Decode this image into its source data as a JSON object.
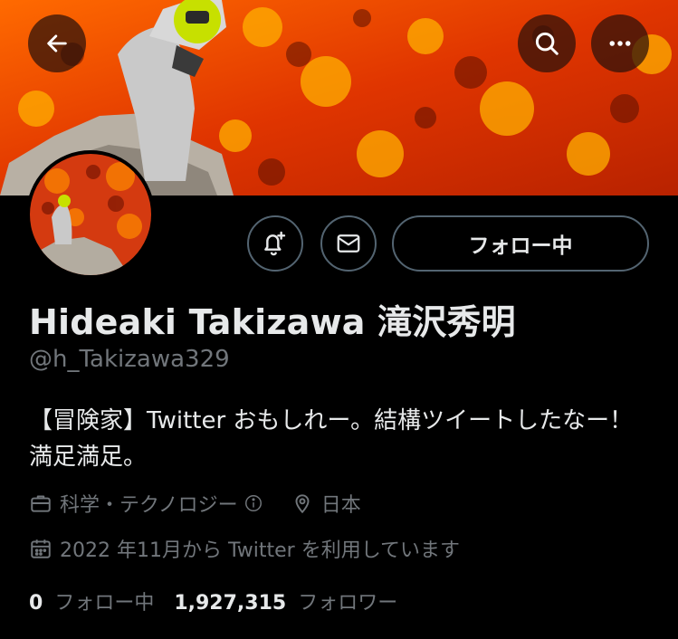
{
  "profile": {
    "name": "Hideaki Takizawa 滝沢秀明",
    "handle": "@h_Takizawa329",
    "bio": "【冒険家】Twitter おもしれー。結構ツイートしたなー！満足満足。",
    "category": "科学・テクノロジー",
    "location": "日本",
    "joined": "2022 年11月から Twitter を利用しています"
  },
  "actions": {
    "follow_label": "フォロー中"
  },
  "stats": {
    "following_count": "0",
    "following_label": "フォロー中",
    "followers_count": "1,927,315",
    "followers_label": "フォロワー"
  },
  "icons": {
    "back": "arrow-left-icon",
    "search": "search-icon",
    "more": "more-horizontal-icon",
    "notify": "bell-plus-icon",
    "message": "envelope-icon",
    "category": "briefcase-icon",
    "info": "info-icon",
    "location": "map-pin-icon",
    "joined": "calendar-icon"
  },
  "colors": {
    "background": "#000000",
    "primary_text": "#e7e9ea",
    "secondary_text": "#71767b",
    "border": "#536471"
  }
}
